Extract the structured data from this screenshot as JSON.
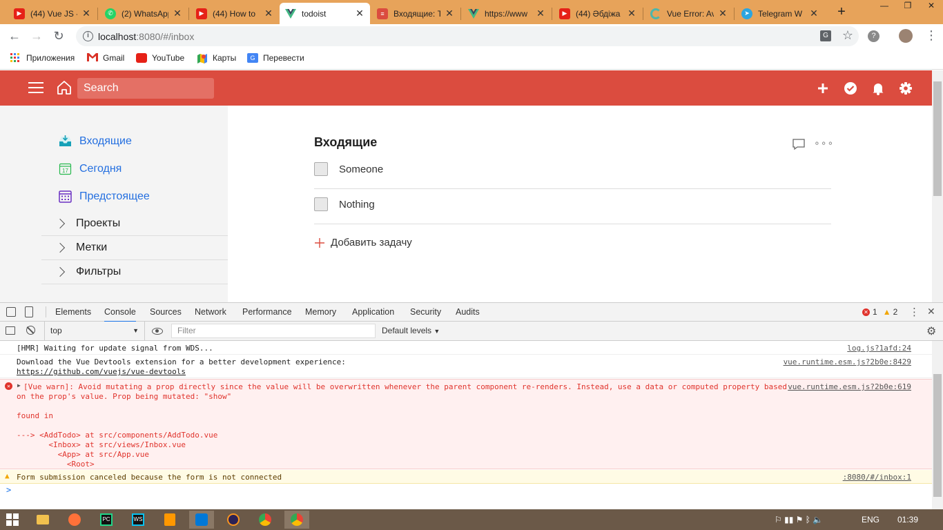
{
  "browser": {
    "tabs": [
      {
        "title": "(44) Vue JS -",
        "icon": "youtube-icon",
        "color": "#e62117"
      },
      {
        "title": "(2) WhatsApp",
        "icon": "whatsapp-icon",
        "color": "#25d366"
      },
      {
        "title": "(44) How to",
        "icon": "youtube-icon",
        "color": "#e62117"
      },
      {
        "title": "todoist",
        "icon": "vue-icon",
        "color": "#41b883"
      },
      {
        "title": "Входящие: T",
        "icon": "todoist-icon",
        "color": "#db4c3f"
      },
      {
        "title": "https://www",
        "icon": "vue-icon",
        "color": "#41b883"
      },
      {
        "title": "(44) Әбдіжа",
        "icon": "youtube-icon",
        "color": "#e62117"
      },
      {
        "title": "Vue Error: Av",
        "icon": "loading-icon",
        "color": "#4db6ac"
      },
      {
        "title": "Telegram W",
        "icon": "telegram-icon",
        "color": "#2ca5e0"
      }
    ],
    "new_tab": "+",
    "address": {
      "host": "localhost",
      "rest": ":8080/#/inbox"
    },
    "bookmarks": [
      {
        "label": "Приложения",
        "icon": "apps-grid-icon"
      },
      {
        "label": "Gmail",
        "icon": "gmail-icon"
      },
      {
        "label": "YouTube",
        "icon": "youtube-icon"
      },
      {
        "label": "Карты",
        "icon": "maps-icon"
      },
      {
        "label": "Перевести",
        "icon": "translate-icon"
      }
    ]
  },
  "app": {
    "search_placeholder": "Search",
    "accent": "#db4c3f",
    "sidebar": {
      "items": [
        {
          "label": "Входящие",
          "icon": "inbox-icon"
        },
        {
          "label": "Сегодня",
          "icon": "calendar-today-icon"
        },
        {
          "label": "Предстоящее",
          "icon": "calendar-upcoming-icon"
        }
      ],
      "groups": [
        "Проекты",
        "Метки",
        "Фильтры"
      ]
    },
    "main": {
      "title": "Входящие",
      "tasks": [
        "Someone",
        "Nothing"
      ],
      "add_task": "Добавить задачу"
    }
  },
  "devtools": {
    "tabs": [
      "Elements",
      "Console",
      "Sources",
      "Network",
      "Performance",
      "Memory",
      "Application",
      "Security",
      "Audits"
    ],
    "active_tab": "Console",
    "errors": "1",
    "warnings": "2",
    "context": "top",
    "filter_placeholder": "Filter",
    "levels": "Default levels",
    "messages": [
      {
        "text": "[HMR] Waiting for update signal from WDS...",
        "source": "log.js?1afd:24"
      },
      {
        "text": "Download the Vue Devtools extension for a better development experience:",
        "link": "https://github.com/vuejs/vue-devtools",
        "source": "vue.runtime.esm.js?2b0e:8429"
      },
      {
        "text": "[Vue warn]: Avoid mutating a prop directly since the value will be overwritten whenever the parent component re-renders. Instead, use a data or computed property based",
        "text2": "on the prop's value. Prop being mutated: \"show\"",
        "text3": "found in",
        "text4": "---> <AddTodo> at src/components/AddTodo.vue",
        "text5": "       <Inbox> at src/views/Inbox.vue",
        "text6": "         <App> at src/App.vue",
        "text7": "           <Root>",
        "source": "vue.runtime.esm.js?2b0e:619"
      },
      {
        "text": "Form submission canceled because the form is not connected",
        "source": ":8080/#/inbox:1"
      }
    ],
    "prompt": ">"
  },
  "taskbar": {
    "lang": "ENG",
    "time": "01:39"
  }
}
